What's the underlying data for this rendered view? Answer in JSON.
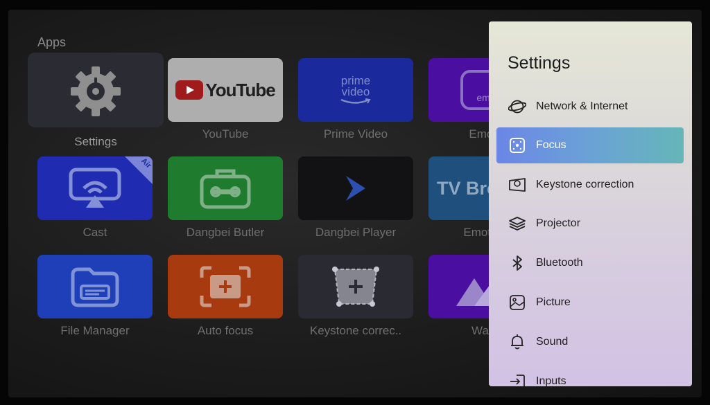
{
  "apps": {
    "title": "Apps",
    "tiles": [
      {
        "label": "Settings"
      },
      {
        "label": "YouTube",
        "logo": "YouTube"
      },
      {
        "label": "Prime Video",
        "logo_line1": "prime",
        "logo_line2": "video"
      },
      {
        "label": "Emotn",
        "logo": "emo"
      },
      {
        "label": "Cast",
        "badge": "Air"
      },
      {
        "label": "Dangbei Butler"
      },
      {
        "label": "Dangbei Player"
      },
      {
        "label": "Emotn B",
        "logo": "TV Bro"
      },
      {
        "label": "File Manager"
      },
      {
        "label": "Auto focus"
      },
      {
        "label": "Keystone correc.."
      },
      {
        "label": "Wallp"
      }
    ]
  },
  "settings_panel": {
    "title": "Settings",
    "items": [
      {
        "label": "Network & Internet",
        "icon": "globe-icon"
      },
      {
        "label": "Focus",
        "icon": "focus-icon",
        "active": true
      },
      {
        "label": "Keystone correction",
        "icon": "keystone-icon"
      },
      {
        "label": "Projector",
        "icon": "layers-icon"
      },
      {
        "label": "Bluetooth",
        "icon": "bluetooth-icon"
      },
      {
        "label": "Picture",
        "icon": "picture-icon"
      },
      {
        "label": "Sound",
        "icon": "bell-icon"
      },
      {
        "label": "Inputs",
        "icon": "input-icon"
      }
    ]
  },
  "colors": {
    "active_gradient_start": "#6b86e6",
    "active_gradient_end": "#65b6b8",
    "youtube_red": "#e02020"
  }
}
